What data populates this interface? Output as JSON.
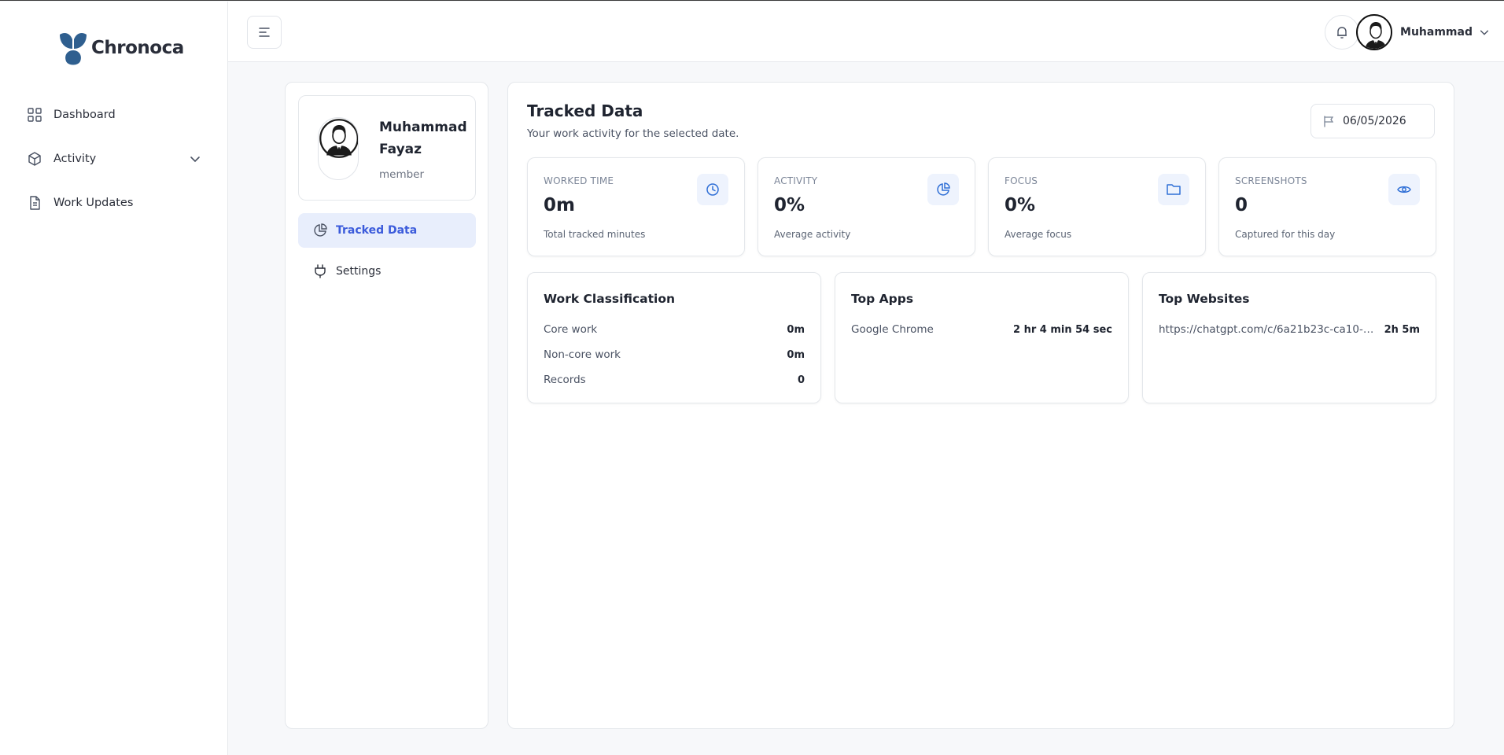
{
  "brand": {
    "name": "Chronoca",
    "primary": "#2f5f8f"
  },
  "sidebar": {
    "items": [
      {
        "label": "Dashboard",
        "icon": "grid-icon"
      },
      {
        "label": "Activity",
        "icon": "cube-icon",
        "has_submenu": true
      },
      {
        "label": "Work Updates",
        "icon": "document-icon"
      }
    ]
  },
  "topbar": {
    "user_name": "Muhammad"
  },
  "profile": {
    "name": "Muhammad Fayaz",
    "role": "member"
  },
  "profile_tabs": [
    {
      "label": "Tracked Data",
      "icon": "pie-chart-icon",
      "active": true
    },
    {
      "label": "Settings",
      "icon": "plug-icon",
      "active": false
    }
  ],
  "main": {
    "title": "Tracked Data",
    "subtitle": "Your work activity for the selected date.",
    "date": "06/05/2026",
    "stats": [
      {
        "label": "WORKED TIME",
        "value": "0m",
        "desc": "Total tracked minutes",
        "icon": "clock-icon"
      },
      {
        "label": "ACTIVITY",
        "value": "0%",
        "desc": "Average activity",
        "icon": "pie-chart-icon"
      },
      {
        "label": "FOCUS",
        "value": "0%",
        "desc": "Average focus",
        "icon": "folder-icon"
      },
      {
        "label": "SCREENSHOTS",
        "value": "0",
        "desc": "Captured for this day",
        "icon": "eye-icon"
      }
    ],
    "work_classification": {
      "title": "Work Classification",
      "rows": [
        {
          "label": "Core work",
          "value": "0m"
        },
        {
          "label": "Non-core work",
          "value": "0m"
        },
        {
          "label": "Records",
          "value": "0"
        }
      ]
    },
    "top_apps": {
      "title": "Top Apps",
      "rows": [
        {
          "label": "Google Chrome",
          "value": "2 hr 4 min 54 sec"
        }
      ]
    },
    "top_websites": {
      "title": "Top Websites",
      "rows": [
        {
          "label": "https://chatgpt.com/c/6a21b23c-ca10-83a7...",
          "value": "2h 5m"
        }
      ]
    }
  },
  "colors": {
    "accent": "#3b5bdb",
    "icon_blue": "#2f6fd6",
    "active_tab_bg": "#e8eefc"
  }
}
